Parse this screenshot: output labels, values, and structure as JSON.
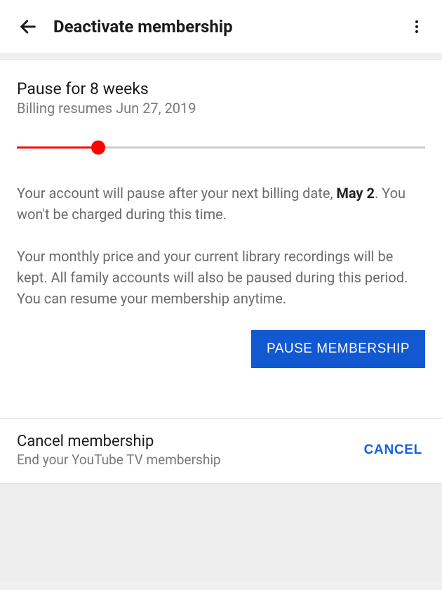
{
  "header": {
    "title": "Deactivate membership"
  },
  "pause": {
    "title": "Pause for 8 weeks",
    "subtitle": "Billing resumes Jun 27, 2019",
    "body1_pre": "Your account will pause after your next billing date, ",
    "body1_date": "May 2",
    "body1_post": ". You won't be charged during this time.",
    "body2": "Your monthly price and your current library recordings will be kept. All family accounts will also be paused during this period. You can resume your membership anytime.",
    "button": "PAUSE MEMBERSHIP",
    "slider": {
      "percent": 20
    }
  },
  "cancel": {
    "title": "Cancel membership",
    "subtitle": "End your YouTube TV membership",
    "button": "CANCEL"
  }
}
